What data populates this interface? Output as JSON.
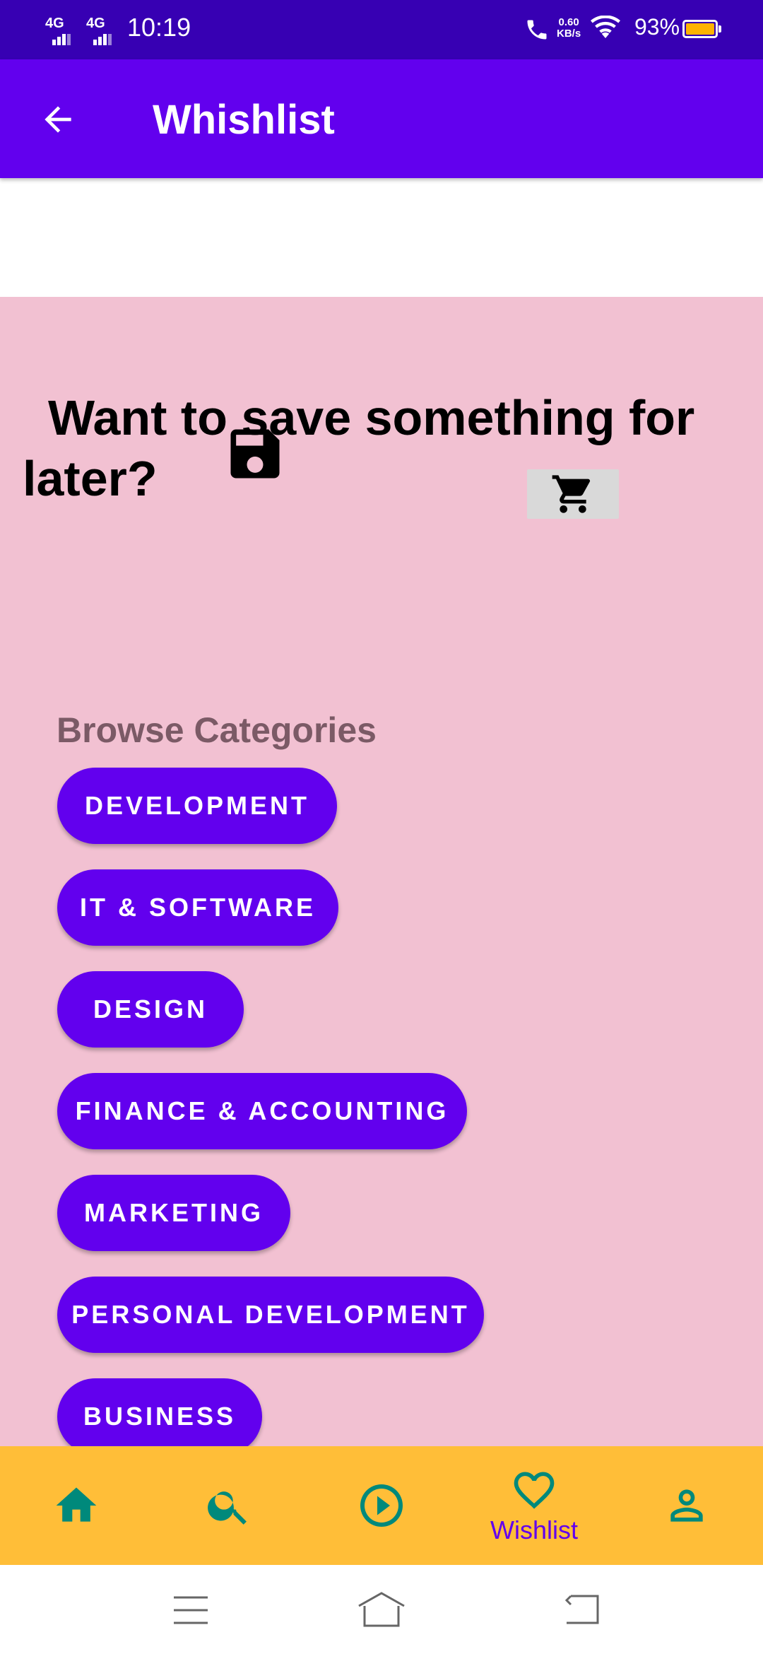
{
  "status_bar": {
    "time": "10:19",
    "signal_1": "4G",
    "signal_2": "4G",
    "net_speed_value": "0.60",
    "net_speed_unit": "KB/s",
    "battery": "93%"
  },
  "app_bar": {
    "title": "Whishlist",
    "back_icon": "arrow-back-icon"
  },
  "empty_state": {
    "title": "Want to save something for later?",
    "save_icon": "floppy-save-icon",
    "cart_icon": "shopping-cart-icon"
  },
  "browse": {
    "label": "Browse Categories",
    "categories": [
      "DEVELOPMENT",
      "IT & SOFTWARE",
      "DESIGN",
      "FINANCE & ACCOUNTING",
      "MARKETING",
      "PERSONAL DEVELOPMENT",
      "BUSINESS"
    ]
  },
  "bottom_nav": {
    "items": [
      {
        "icon": "home-icon"
      },
      {
        "icon": "search-icon"
      },
      {
        "icon": "play-circle-icon"
      },
      {
        "icon": "heart-icon",
        "label": "Wishlist",
        "selected": true
      },
      {
        "icon": "person-icon"
      }
    ]
  },
  "colors": {
    "primary": "#6200ee",
    "primary_dark": "#3700b3",
    "content_bg": "#f2c1d2",
    "bottom_nav_bg": "#ffbe38",
    "nav_icon": "#00897b"
  }
}
